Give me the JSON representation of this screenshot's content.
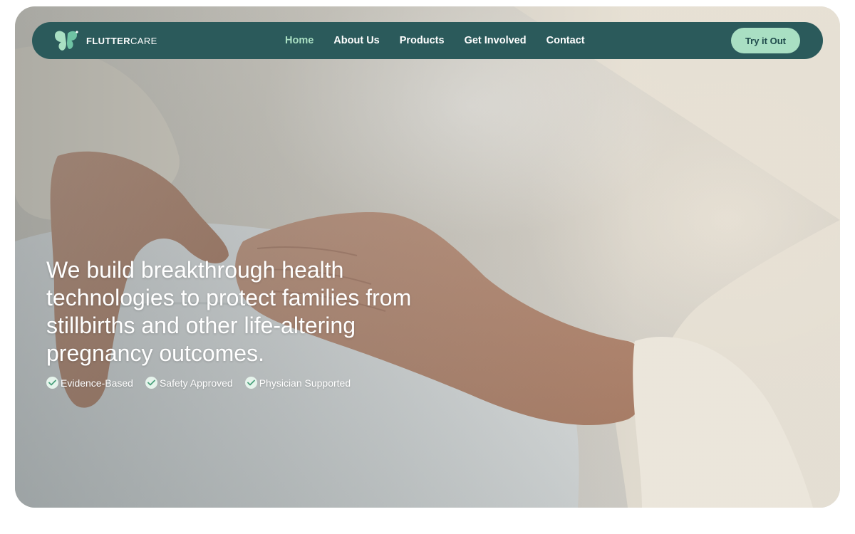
{
  "brand": {
    "name_bold": "FLUTTER",
    "name_light": "CARE",
    "logo_icon": "butterfly-icon"
  },
  "nav": {
    "links": [
      {
        "label": "Home",
        "active": true
      },
      {
        "label": "About Us",
        "active": false
      },
      {
        "label": "Products",
        "active": false
      },
      {
        "label": "Get Involved",
        "active": false
      },
      {
        "label": "Contact",
        "active": false
      }
    ],
    "cta_label": "Try it Out"
  },
  "hero": {
    "headline": "We build breakthrough health technologies to protect families from stillbirths and other life-altering pregnancy outcomes.",
    "badges": [
      {
        "label": "Evidence-Based",
        "icon": "check-circle-icon"
      },
      {
        "label": "Safety Approved",
        "icon": "check-circle-icon"
      },
      {
        "label": "Physician Supported",
        "icon": "check-circle-icon"
      }
    ]
  },
  "colors": {
    "nav_bg": "#2b5a5b",
    "accent": "#a9dfc3",
    "cta_text": "#1f4a4b"
  }
}
